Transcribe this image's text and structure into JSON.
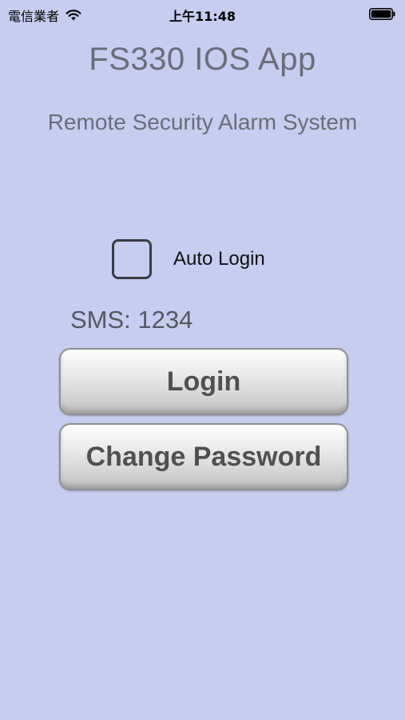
{
  "status_bar": {
    "carrier": "電信業者",
    "time": "上午11:48"
  },
  "header": {
    "title": "FS330 IOS App",
    "subtitle": "Remote Security Alarm System"
  },
  "auto_login": {
    "label": "Auto Login",
    "checked": false
  },
  "sms": {
    "text": "SMS: 1234"
  },
  "buttons": {
    "login_label": "Login",
    "change_password_label": "Change Password"
  },
  "icons": {
    "wifi": "wifi-icon",
    "battery": "battery-icon"
  },
  "colors": {
    "background": "#c6cdef",
    "title_text": "#6a6d78",
    "button_text": "#505050"
  }
}
